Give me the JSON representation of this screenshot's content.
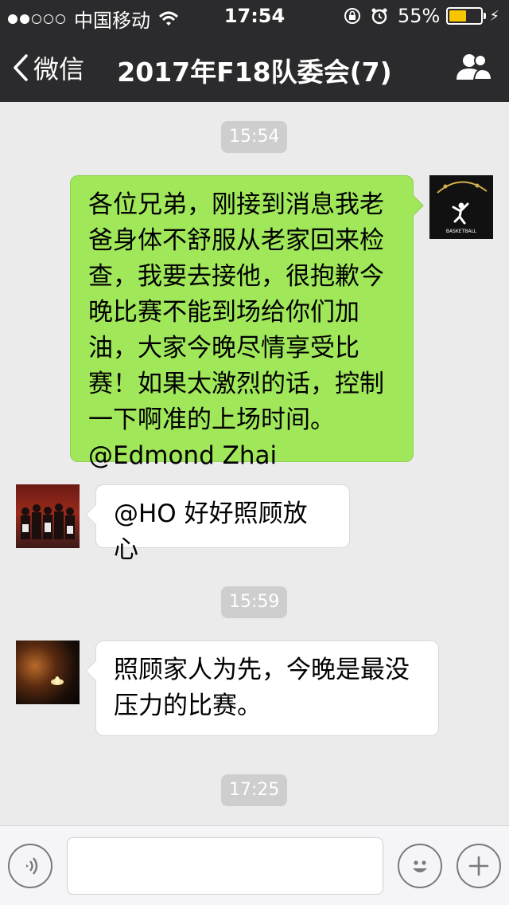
{
  "status_bar": {
    "carrier": "中国移动",
    "time": "17:54",
    "battery": "55%",
    "battery_level": 0.55,
    "signal_bars_filled": 2,
    "signal_bars_total": 5
  },
  "nav": {
    "back_label": "微信",
    "title": "2017年F18队委会(7)"
  },
  "messages": [
    {
      "type": "timestamp",
      "text": "15:54"
    },
    {
      "type": "outgoing",
      "text": "各位兄弟，刚接到消息我老爸身体不舒服从老家回来检查，我要去接他，很抱歉今晚比赛不能到场给你们加油，大家今晚尽情享受比赛！如果太激烈的话，控制一下啊准的上场时间。@Edmond Zhai",
      "avatar_text": "BASKETBALL"
    },
    {
      "type": "incoming",
      "text": "@HO 好好照顾放心"
    },
    {
      "type": "timestamp",
      "text": "15:59"
    },
    {
      "type": "incoming",
      "text": "照顾家人为先，今晚是最没压力的比赛。"
    },
    {
      "type": "timestamp",
      "text": "17:25"
    }
  ],
  "colors": {
    "header_bg": "#2b2b2d",
    "chat_bg": "#ebebeb",
    "outgoing_bubble": "#a0e75a",
    "incoming_bubble": "#ffffff",
    "timestamp_bg": "#cecece",
    "battery_fill": "#f7c600"
  },
  "icons": {
    "back": "chevron-left-icon",
    "group": "group-members-icon",
    "voice": "voice-icon",
    "emoji": "emoji-icon",
    "plus": "plus-icon"
  }
}
